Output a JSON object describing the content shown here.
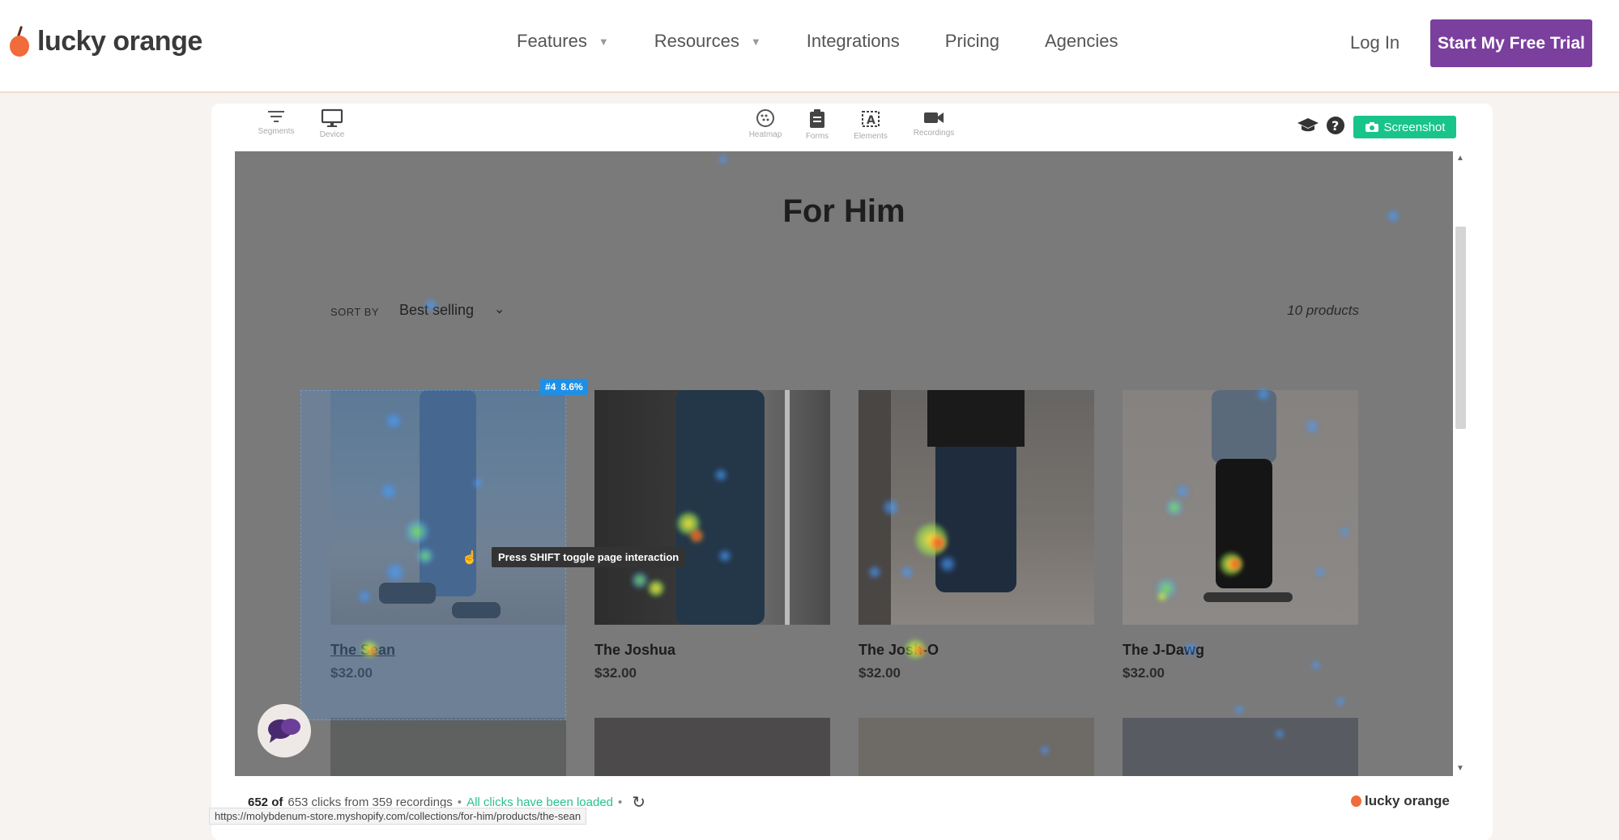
{
  "nav": {
    "logo": "lucky orange",
    "links": [
      "Features",
      "Resources",
      "Integrations",
      "Pricing",
      "Agencies"
    ],
    "caret": "▼",
    "login": "Log In",
    "cta": "Start My Free Trial"
  },
  "toolbar": {
    "segments": "Segments",
    "device": "Device",
    "heatmap": "Heatmap",
    "forms": "Forms",
    "elements": "Elements",
    "recordings": "Recordings",
    "screenshot": "Screenshot"
  },
  "page": {
    "title": "For Him",
    "sort_label": "SORT BY",
    "sort_value": "Best selling",
    "count": "10 products",
    "products": [
      {
        "name": "The Sean",
        "price": "$32.00"
      },
      {
        "name": "The Joshua",
        "price": "$32.00"
      },
      {
        "name": "The Josh-O",
        "price": "$32.00"
      },
      {
        "name": "The J-Dawg",
        "price": "$32.00"
      }
    ]
  },
  "overlay": {
    "rank": "#4",
    "percent": "8.6%",
    "tooltip": "Press SHIFT toggle page interaction"
  },
  "footer": {
    "shown": "652 of",
    "summary": "653 clicks from 359 recordings",
    "sep": "•",
    "loaded": "All clicks have been loaded",
    "logo": "lucky orange",
    "url": "https://molybdenum-store.myshopify.com/collections/for-him/products/the-sean"
  },
  "colors": {
    "brand_purple": "#7b3f9e",
    "brand_orange": "#f26b3a",
    "screenshot_green": "#19c48a",
    "badge_blue": "#1f8fe6"
  }
}
